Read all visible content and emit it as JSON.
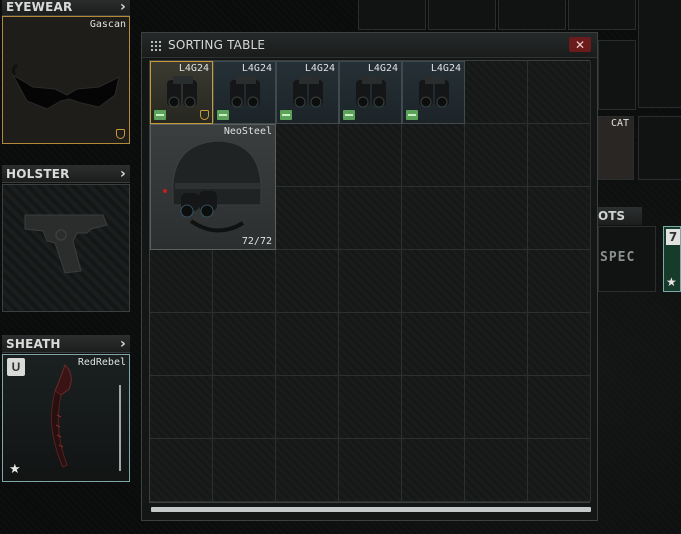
{
  "equipment": {
    "eyewear": {
      "label": "EYEWEAR",
      "item_name": "Gascan"
    },
    "holster": {
      "label": "HOLSTER"
    },
    "sheath": {
      "label": "SHEATH",
      "item_name": "RedRebel",
      "rarity_badge": "U"
    }
  },
  "background": {
    "pockets_label": "OTS",
    "spec_text": "SPEC",
    "cat_label": "CAT",
    "card_number": "7"
  },
  "window": {
    "title": "SORTING TABLE",
    "close_glyph": "✕",
    "items": [
      {
        "name": "L4G24"
      },
      {
        "name": "L4G24"
      },
      {
        "name": "L4G24"
      },
      {
        "name": "L4G24"
      },
      {
        "name": "L4G24"
      }
    ],
    "helmet": {
      "name": "NeoSteel",
      "durability": "72/72"
    }
  },
  "colors": {
    "accent_gold": "#c99a37",
    "close_red": "#6a1b1b",
    "battery_green": "#5da25a"
  },
  "icons": [
    "grip-icon",
    "close-icon",
    "chevron-right-icon",
    "shield-icon",
    "battery-icon",
    "star-icon"
  ]
}
